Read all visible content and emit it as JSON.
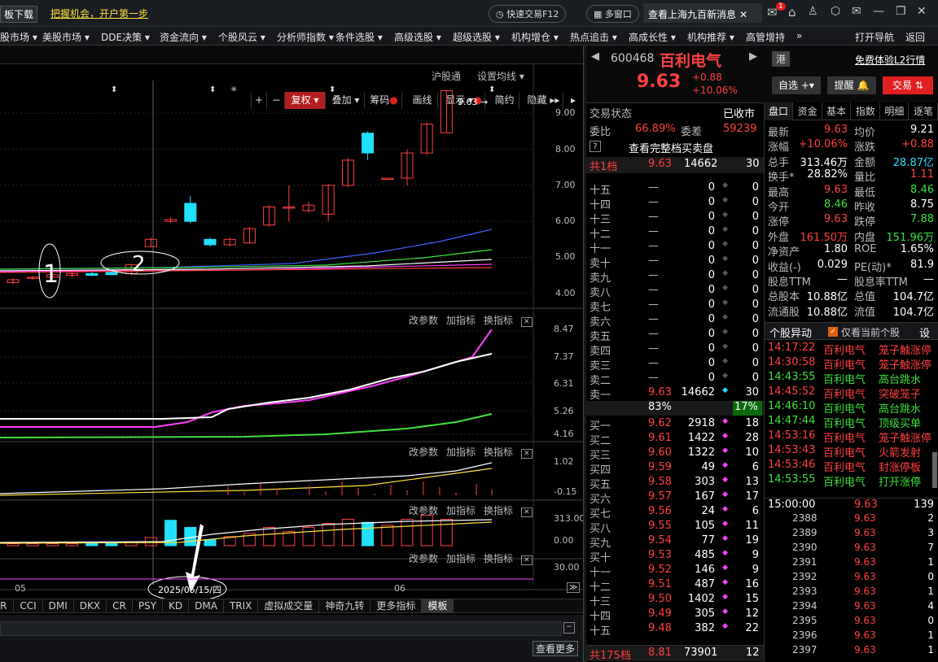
{
  "topbar": {
    "download": "板下载",
    "promo": "把握机会，开户第一步",
    "quick_trade": "快速交易F12",
    "multi_window": "多窗口",
    "news": "查看上海九百新消息",
    "badge": "1"
  },
  "menu": [
    "股市场",
    "美股市场",
    "DDE决策",
    "资金流向",
    "个股风云",
    "分析师指数",
    "条件选股",
    "高级选股",
    "超级选股",
    "机构增仓",
    "热点追击",
    "高成长性",
    "机构推荐",
    "高管增持",
    "»",
    "打开导航",
    "返回"
  ],
  "chart_toolbar": {
    "plus": "+",
    "minus": "−",
    "fuquan": "复权",
    "overlay": "叠加",
    "chips": "筹码",
    "draw": "画线",
    "display": "显示",
    "simple": "简约",
    "hide": "隐藏"
  },
  "chart_header": {
    "hgt": "沪股通",
    "ma": "设置均线"
  },
  "price_axis": [
    "9.00",
    "8.00",
    "7.00",
    "6.00",
    "5.00",
    "4.00"
  ],
  "max_label": "9.63",
  "annotations": {
    "a1": "1",
    "a2": "2",
    "date": "2025/05/15/四"
  },
  "panel_ctrl": {
    "params": "改参数",
    "add": "加指标",
    "switch": "换指标"
  },
  "ind1_axis": [
    "8.47",
    "7.37",
    "6.31",
    "5.26",
    "4.16"
  ],
  "ind2_axis": [
    "1.02",
    "-0.15"
  ],
  "ind3_axis": [
    "313.00",
    "0.00"
  ],
  "ind4_axis": [
    "30.00"
  ],
  "x_labels": [
    "05",
    "06"
  ],
  "indicator_tabs": [
    "R",
    "CCI",
    "DMI",
    "DKX",
    "CR",
    "PSY",
    "KD",
    "DMA",
    "TRIX",
    "虚拟成交量",
    "神奇九转",
    "更多指标",
    "模板"
  ],
  "bottom": {
    "more": "查看更多"
  },
  "stock": {
    "code": "600468",
    "name": "百利电气",
    "price": "9.63",
    "change": "+0.88",
    "pct": "+10.06%",
    "hk": "港",
    "l2": "免费体验L2行情",
    "self_select": "自选",
    "remind": "提醒",
    "trade": "交易"
  },
  "order": {
    "status_label": "交易状态",
    "status": "已收市",
    "weibi_label": "委比",
    "weibi": "66.89%",
    "weicha_label": "委差",
    "weicha": "59239",
    "full": "查看完整档买卖盘",
    "total1_label": "共1档",
    "total1_price": "9.63",
    "total1_vol": "14662",
    "total1_n": "30",
    "sells": [
      [
        "十五",
        "—",
        "0",
        "0"
      ],
      [
        "十四",
        "—",
        "0",
        "0"
      ],
      [
        "十三",
        "—",
        "0",
        "0"
      ],
      [
        "十二",
        "—",
        "0",
        "0"
      ],
      [
        "十一",
        "—",
        "0",
        "0"
      ],
      [
        "卖十",
        "—",
        "0",
        "0"
      ],
      [
        "卖九",
        "—",
        "0",
        "0"
      ],
      [
        "卖八",
        "—",
        "0",
        "0"
      ],
      [
        "卖七",
        "—",
        "0",
        "0"
      ],
      [
        "卖六",
        "—",
        "0",
        "0"
      ],
      [
        "卖五",
        "—",
        "0",
        "0"
      ],
      [
        "卖四",
        "—",
        "0",
        "0"
      ],
      [
        "卖三",
        "—",
        "0",
        "0"
      ],
      [
        "卖二",
        "—",
        "0",
        "0"
      ],
      [
        "卖一",
        "9.63",
        "14662",
        "30"
      ]
    ],
    "ratio_left": "83%",
    "ratio_right": "17%",
    "buys": [
      [
        "买一",
        "9.62",
        "2918",
        "18"
      ],
      [
        "买二",
        "9.61",
        "1422",
        "28"
      ],
      [
        "买三",
        "9.60",
        "1322",
        "10"
      ],
      [
        "买四",
        "9.59",
        "49",
        "6"
      ],
      [
        "买五",
        "9.58",
        "303",
        "13"
      ],
      [
        "买六",
        "9.57",
        "167",
        "17"
      ],
      [
        "买七",
        "9.56",
        "24",
        "6"
      ],
      [
        "买八",
        "9.55",
        "105",
        "11"
      ],
      [
        "买九",
        "9.54",
        "77",
        "19"
      ],
      [
        "买十",
        "9.53",
        "485",
        "9"
      ],
      [
        "十一",
        "9.52",
        "146",
        "9"
      ],
      [
        "十二",
        "9.51",
        "487",
        "16"
      ],
      [
        "十三",
        "9.50",
        "1402",
        "15"
      ],
      [
        "十四",
        "9.49",
        "305",
        "12"
      ],
      [
        "十五",
        "9.48",
        "382",
        "22"
      ]
    ],
    "total175_label": "共175档",
    "total175_price": "8.81",
    "total175_vol": "73901",
    "total175_n": "12"
  },
  "quote_tabs": [
    "盘口",
    "资金",
    "基本",
    "指数",
    "明细",
    "逐笔"
  ],
  "quote": [
    [
      "最新",
      "9.63",
      "均价",
      "9.21"
    ],
    [
      "涨幅",
      "+10.06%",
      "涨跌",
      "+0.88"
    ],
    [
      "总手",
      "313.46万",
      "金额",
      "28.87亿"
    ],
    [
      "换手*",
      "28.82%",
      "量比",
      "1.11"
    ],
    [
      "最高",
      "9.63",
      "最低",
      "8.46"
    ],
    [
      "今开",
      "8.46",
      "昨收",
      "8.75"
    ],
    [
      "涨停",
      "9.63",
      "跌停",
      "7.88"
    ],
    [
      "外盘",
      "161.50万",
      "内盘",
      "151.96万"
    ],
    [
      "净资产",
      "1.80",
      "ROE",
      "1.65%"
    ],
    [
      "收益(-)",
      "0.029",
      "PE(动)*",
      "81.9"
    ],
    [
      "股息TTM",
      "—",
      "股息率TTM",
      "—"
    ],
    [
      "总股本",
      "10.88亿",
      "总值",
      "104.7亿"
    ],
    [
      "流通股",
      "10.88亿",
      "流值",
      "104.7亿"
    ]
  ],
  "anomaly": {
    "title": "个股异动",
    "only_current": "仅看当前个股",
    "settings": "设",
    "items": [
      [
        "14:17:22",
        "百利电气",
        "笼子触涨停"
      ],
      [
        "14:30:58",
        "百利电气",
        "笼子触涨停"
      ],
      [
        "14:43:55",
        "百利电气",
        "高台跳水"
      ],
      [
        "14:45:52",
        "百利电气",
        "突破笼子"
      ],
      [
        "14:46:10",
        "百利电气",
        "高台跳水"
      ],
      [
        "14:47:44",
        "百利电气",
        "顶级买单"
      ],
      [
        "14:53:16",
        "百利电气",
        "笼子触涨停"
      ],
      [
        "14:53:43",
        "百利电气",
        "火箭发射"
      ],
      [
        "14:53:46",
        "百利电气",
        "封涨停板"
      ],
      [
        "14:53:55",
        "百利电气",
        "打开涨停"
      ]
    ]
  },
  "ticks": [
    [
      "15:00:00",
      "9.63",
      "139"
    ],
    [
      "2388",
      "9.63",
      "2"
    ],
    [
      "2389",
      "9.63",
      "3"
    ],
    [
      "2390",
      "9.63",
      "7"
    ],
    [
      "2391",
      "9.63",
      "1"
    ],
    [
      "2392",
      "9.63",
      "0"
    ],
    [
      "2393",
      "9.63",
      "1"
    ],
    [
      "2394",
      "9.63",
      "4"
    ],
    [
      "2395",
      "9.63",
      "0"
    ],
    [
      "2396",
      "9.63",
      "1"
    ],
    [
      "2397",
      "9.63",
      "1"
    ]
  ],
  "candles": [
    [
      4.3,
      4.38,
      4.25,
      4.42
    ],
    [
      4.42,
      4.45,
      4.38,
      4.48
    ],
    [
      4.45,
      4.52,
      4.42,
      4.55
    ],
    [
      4.5,
      4.55,
      4.45,
      4.58
    ],
    [
      4.55,
      4.5,
      4.48,
      4.6
    ],
    [
      4.58,
      4.52,
      4.5,
      4.62
    ],
    [
      4.55,
      4.8,
      4.5,
      4.82
    ],
    [
      5.3,
      5.5,
      5.28,
      5.55
    ],
    [
      6.0,
      6.05,
      5.95,
      6.12
    ],
    [
      6.5,
      6.0,
      5.95,
      6.7
    ],
    [
      5.5,
      5.35,
      5.3,
      5.55
    ],
    [
      5.35,
      5.5,
      5.3,
      5.55
    ],
    [
      5.4,
      5.8,
      5.38,
      5.85
    ],
    [
      5.9,
      6.4,
      5.85,
      6.45
    ],
    [
      6.4,
      6.4,
      6.0,
      7.0
    ],
    [
      6.3,
      6.45,
      6.25,
      6.55
    ],
    [
      6.2,
      7.0,
      6.0,
      7.05
    ],
    [
      7.0,
      7.7,
      6.95,
      7.75
    ],
    [
      8.45,
      7.9,
      7.7,
      8.5
    ],
    [
      7.2,
      7.2,
      7.2,
      7.2
    ],
    [
      7.2,
      7.9,
      7.0,
      8.0
    ],
    [
      7.9,
      8.7,
      7.85,
      8.75
    ],
    [
      8.46,
      9.63,
      8.46,
      9.63
    ]
  ]
}
